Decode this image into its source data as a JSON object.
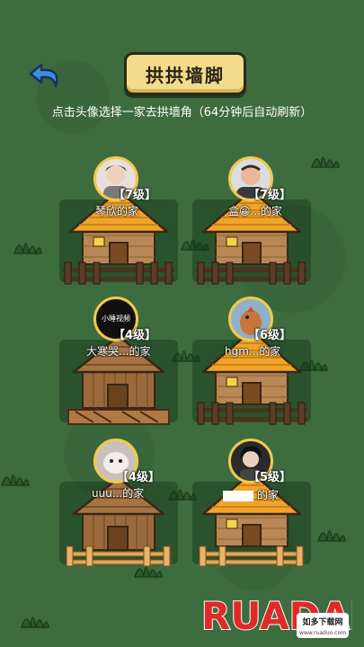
{
  "header": {
    "title": "拱拱墙脚",
    "subtitle": "点击头像选择一家去拱墙角（64分钟后自动刷新）"
  },
  "houses": [
    {
      "level": "【7级】",
      "owner": "琴欣的家",
      "roof": "tiled"
    },
    {
      "level": "【7级】",
      "owner": "盒😀...的家",
      "roof": "tiled"
    },
    {
      "level": "【4级】",
      "owner": "大寒哭...的家",
      "roof": "wood",
      "avatar_text": "小睡视频"
    },
    {
      "level": "【6级】",
      "owner": "hgm...的家",
      "roof": "tiled"
    },
    {
      "level": "【4级】",
      "owner": "uuu...的家",
      "roof": "wood"
    },
    {
      "level": "【5级】",
      "owner": "的家",
      "roof": "tiled"
    }
  ],
  "watermark": {
    "brand": "RUADADUO",
    "site_cn": "如多下载网",
    "site_url": "www.ruaduo.com"
  },
  "colors": {
    "background": "#3d6c3f",
    "banner": "#f2dc8c",
    "roof_tiled": "#f0a52a",
    "roof_wood": "#a57544",
    "avatar_border": "#f2c94c"
  },
  "icons": {
    "back": "back-arrow-icon",
    "grass": "grass-tuft-icon"
  }
}
